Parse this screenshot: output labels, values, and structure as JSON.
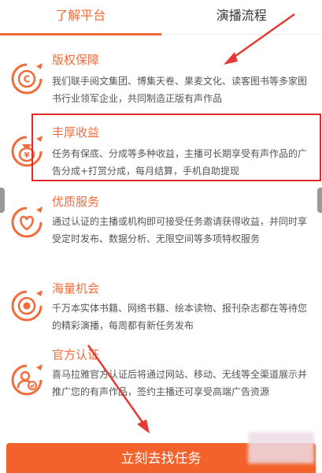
{
  "tabs": [
    {
      "label": "了解平台",
      "active": true
    },
    {
      "label": "演播流程",
      "active": false
    }
  ],
  "features": [
    {
      "title": "版权保障",
      "desc": "我们联手阅文集团、博集天卷、果麦文化、读客图书等多家图书行业领军企业，共同制造正版有声作品",
      "icon": "copyright-icon"
    },
    {
      "title": "丰厚收益",
      "desc": "任务有保底、分成等多种收益，主播可长期享受有声作品的广告分成+打赏分成，每月结算，手机自助提现",
      "icon": "money-bag-icon"
    },
    {
      "title": "优质服务",
      "desc": "通过认证的主播或机构即可接受任务邀请获得收益，并同时享受定时发布、数据分析、无限空间等多项特权服务",
      "icon": "heart-icon"
    },
    {
      "title": "海量机会",
      "desc": "千万本实体书籍、网络书籍、绘本读物、报刊杂志都在等待您的精彩演播，每周都有新任务发布",
      "icon": "target-icon"
    },
    {
      "title": "官方认证",
      "desc": "喜马拉雅官方认证后将通过网站、移动、无线等全渠道展示并推广您的有声作品，签约主播还可享受高端广告资源",
      "icon": "certified-user-icon"
    }
  ],
  "cta": {
    "label": "立刻去找任务"
  },
  "colors": {
    "accent": "#f26b3a",
    "highlight": "#e02a2a",
    "cta": "#f3622a"
  }
}
